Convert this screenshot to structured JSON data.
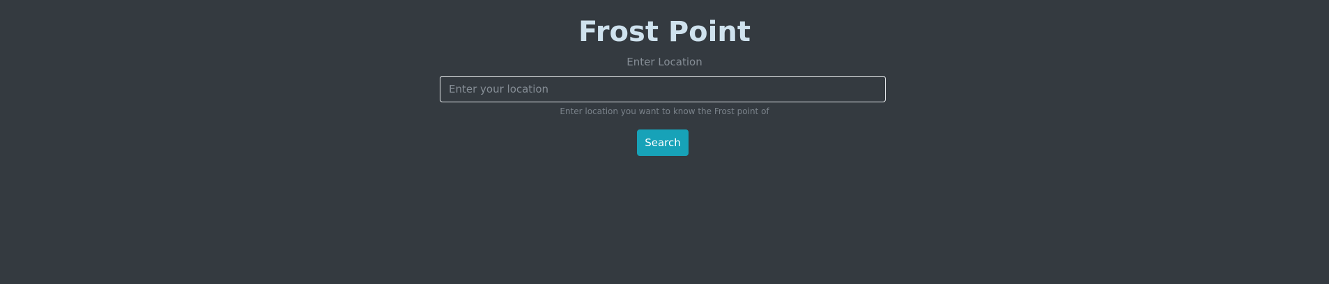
{
  "header": {
    "title": "Frost Point"
  },
  "form": {
    "label": "Enter Location",
    "location_input": {
      "value": "",
      "placeholder": "Enter your location"
    },
    "help_text": "Enter location you want to know the Frost point of",
    "search_button_label": "Search"
  },
  "colors": {
    "background": "#343a40",
    "title": "#cfe2ee",
    "muted_text": "#868e96",
    "input_border": "#e9ecef",
    "button": "#17a2b8",
    "button_text": "#ffffff"
  }
}
